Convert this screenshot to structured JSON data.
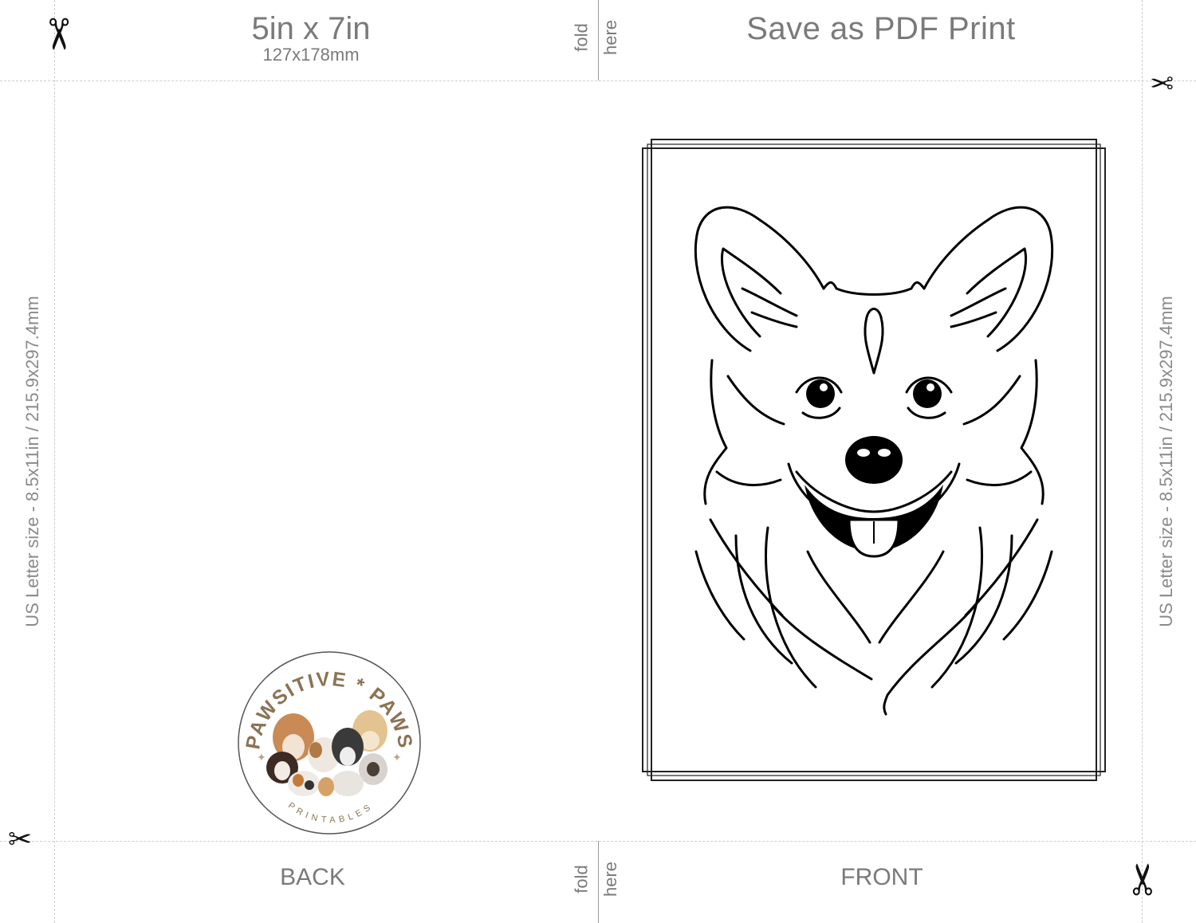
{
  "header": {
    "size_title": "5in x 7in",
    "size_subtitle": "127x178mm",
    "action_text": "Save as PDF Print"
  },
  "fold": {
    "word_fold": "fold",
    "word_here": "here"
  },
  "sides": {
    "left_label": "US Letter size - 8.5x11in / 215.9x297.4mm",
    "right_label": "US Letter size - 8.5x11in / 215.9x297.4mm"
  },
  "panels": {
    "back_label": "BACK",
    "front_label": "FRONT"
  },
  "logo": {
    "brand_top": "PAWSITIVE * PAWS",
    "brand_bottom": "PRINTABLES"
  },
  "icons": {
    "scissors": "scissors-icon",
    "dog": "corgi-line-art"
  },
  "colors": {
    "text_gray": "#7a7a7a",
    "logo_brown": "#8b7355"
  }
}
